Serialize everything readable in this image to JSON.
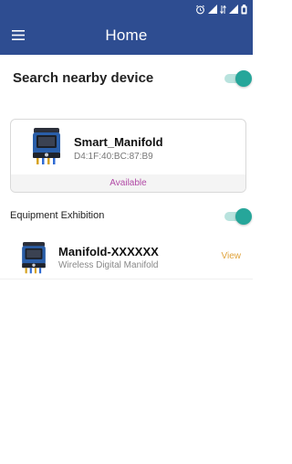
{
  "app_bar": {
    "title": "Home"
  },
  "search": {
    "label": "Search nearby device",
    "enabled": true
  },
  "nearby_devices": [
    {
      "name": "Smart_Manifold",
      "mac": "D4:1F:40:BC:87:B9",
      "status": "Available"
    }
  ],
  "equipment": {
    "label": "Equipment Exhibition",
    "enabled": true,
    "items": [
      {
        "name": "Manifold-XXXXXX",
        "subtitle": "Wireless Digital Manifold",
        "action": "View"
      }
    ]
  },
  "colors": {
    "app_bar": "#2e4d91",
    "toggle_on": "#26a69a",
    "status_available": "#b14aa6",
    "view_link": "#e0a33c"
  }
}
